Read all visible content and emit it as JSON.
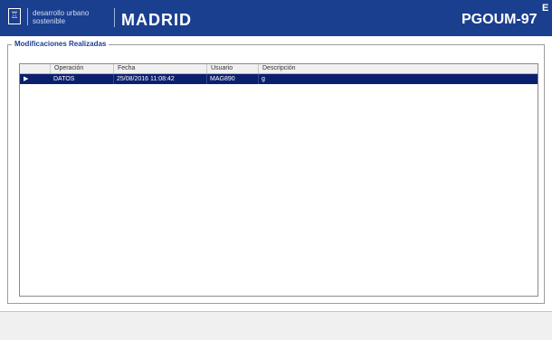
{
  "header": {
    "logo_glyph": "♖",
    "org_line1": "desarrollo urbano",
    "org_line2": "sostenible",
    "city": "MADRID",
    "product": "PGOUM-97",
    "corner_glyph": "E"
  },
  "panel": {
    "legend": "Modificaciones Realizadas"
  },
  "grid": {
    "columns": [
      "Operación",
      "Fecha",
      "Usuario",
      "Descripción"
    ],
    "rows": [
      {
        "indicator": "▶",
        "selected": true,
        "operacion": "DATOS",
        "fecha": "25/08/2016 11:08:42",
        "usuario": "MAG890",
        "descripcion": "g"
      }
    ]
  },
  "colors": {
    "header_bg": "#1b3f8f",
    "selected_row_bg": "#0a1f6e",
    "legend_text": "#1b3f8f"
  }
}
